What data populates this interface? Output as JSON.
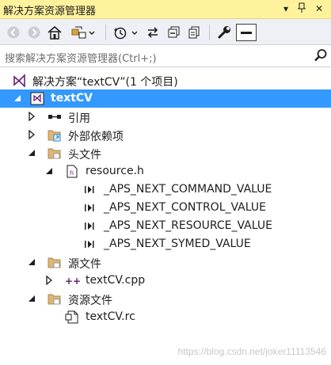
{
  "window": {
    "title": "解决方案资源管理器"
  },
  "search": {
    "placeholder": "搜索解决方案资源管理器(Ctrl+;)"
  },
  "toolbar": {
    "tools": [
      "back-icon",
      "forward-icon",
      "home-icon",
      "sync-icon",
      "history-icon",
      "switch-views-icon",
      "collapse-all-icon",
      "show-all-files-icon",
      "properties-icon",
      "preview-icon"
    ]
  },
  "tree": {
    "solution": "解决方案“textCV”(1 个项目)",
    "project": "textCV",
    "references": "引用",
    "external_deps": "外部依赖项",
    "headers": "头文件",
    "resource_h": "resource.h",
    "macro_1": "_APS_NEXT_COMMAND_VALUE",
    "macro_2": "_APS_NEXT_CONTROL_VALUE",
    "macro_3": "_APS_NEXT_RESOURCE_VALUE",
    "macro_4": "_APS_NEXT_SYMED_VALUE",
    "sources": "源文件",
    "cpp_file": "textCV.cpp",
    "resources": "资源文件",
    "rc_file": "textCV.rc"
  },
  "watermark": "https://blog.csdn.net/joker11113546",
  "colors": {
    "title_bg": "#fff29d",
    "selection": "#3399ff",
    "toolbar_bg": "#eef0f5"
  }
}
